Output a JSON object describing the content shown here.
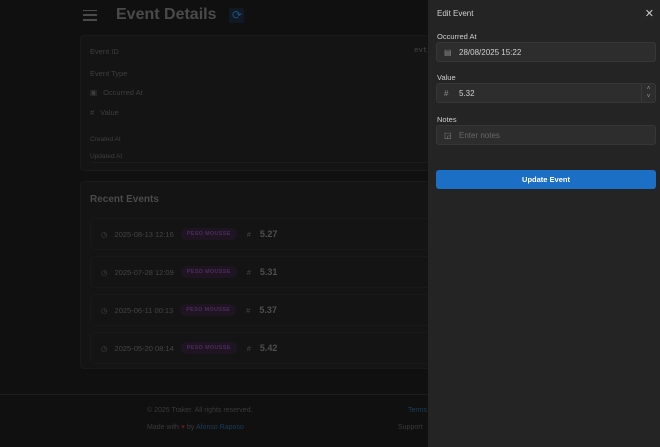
{
  "header": {
    "title": "Event Details"
  },
  "details": {
    "event_id_label": "Event ID",
    "event_id_value": "evt_",
    "event_type_label": "Event Type",
    "occurred_label": "Occurred At",
    "value_label": "Value",
    "created_label": "Created At",
    "updated_label": "Updated At"
  },
  "recent": {
    "title": "Recent Events",
    "items": [
      {
        "time": "2025-08-13 12:16",
        "type": "PESO MOUSSE",
        "value": "5.27"
      },
      {
        "time": "2025-07-28 12:09",
        "type": "PESO MOUSSE",
        "value": "5.31"
      },
      {
        "time": "2025-06-11 00:13",
        "type": "PESO MOUSSE",
        "value": "5.37"
      },
      {
        "time": "2025-05-20 08:14",
        "type": "PESO MOUSSE",
        "value": "5.42"
      }
    ]
  },
  "footer": {
    "copyright": "© 2025 Traker. All rights reserved.",
    "made_with": "Made with",
    "by": "by",
    "author": "Afonso Raposo",
    "terms": "Terms",
    "support": "Support"
  },
  "drawer": {
    "title": "Edit Event",
    "occurred_label": "Occurred At",
    "occurred_value": "28/08/2025 15:22",
    "value_label": "Value",
    "value_value": "5.32",
    "notes_label": "Notes",
    "notes_placeholder": "Enter notes",
    "submit": "Update Event"
  }
}
